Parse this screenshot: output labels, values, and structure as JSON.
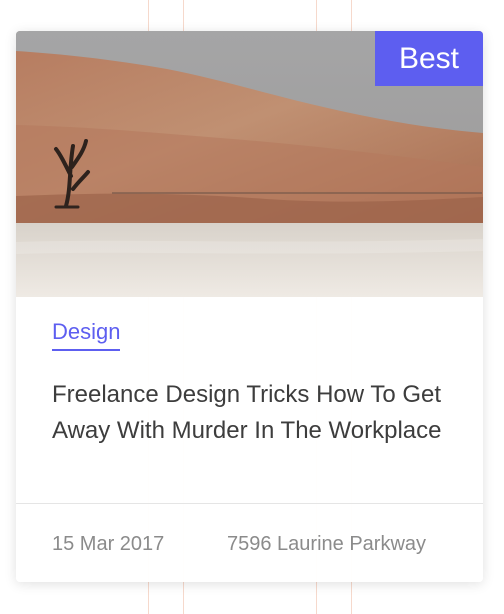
{
  "badge": {
    "label": "Best"
  },
  "post": {
    "category": "Design",
    "title": "Freelance Design Tricks How To Get Away With Murder In The Workplace",
    "date": "15 Mar 2017",
    "location": "7596 Laurine Parkway"
  },
  "colors": {
    "accent": "#5d5ef0",
    "title_text": "#3d3d3d",
    "meta_text": "#8b8b8b"
  }
}
